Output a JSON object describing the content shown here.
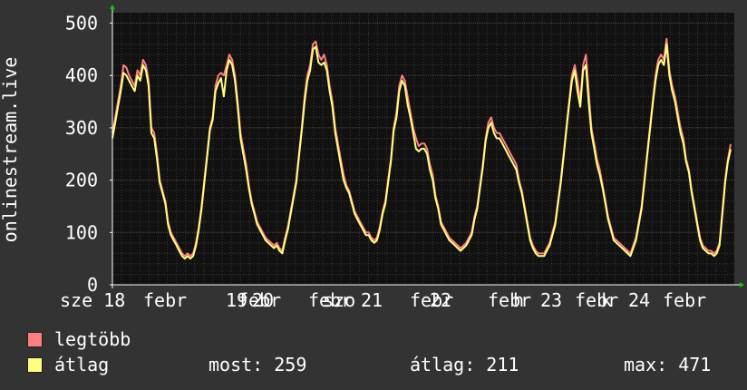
{
  "chart_data": {
    "type": "line",
    "ylabel": "onlinestream.live",
    "ylim": [
      0,
      520
    ],
    "yticks": [
      0,
      100,
      200,
      300,
      400,
      500
    ],
    "grid": true,
    "x_tick_labels": [
      "sze 18",
      "febr",
      "19",
      "febr",
      "20",
      "febr",
      "szo",
      "21",
      "febr",
      "22",
      "febr",
      "h",
      "23",
      "febr",
      "k",
      "24",
      "febr"
    ],
    "series": [
      {
        "name": "legtöbb",
        "color": "#ff7f7f",
        "values": [
          290,
          320,
          350,
          380,
          420,
          415,
          400,
          390,
          380,
          410,
          400,
          430,
          420,
          390,
          300,
          290,
          250,
          200,
          180,
          160,
          120,
          100,
          90,
          80,
          70,
          60,
          55,
          60,
          55,
          60,
          80,
          110,
          150,
          200,
          250,
          300,
          320,
          380,
          400,
          405,
          400,
          420,
          440,
          430,
          400,
          350,
          290,
          260,
          230,
          190,
          160,
          140,
          120,
          110,
          100,
          90,
          85,
          80,
          75,
          80,
          70,
          65,
          90,
          110,
          140,
          170,
          200,
          250,
          300,
          360,
          400,
          420,
          460,
          465,
          440,
          430,
          440,
          420,
          380,
          350,
          300,
          270,
          240,
          210,
          190,
          180,
          160,
          140,
          130,
          120,
          110,
          100,
          100,
          90,
          85,
          90,
          110,
          140,
          160,
          200,
          240,
          300,
          330,
          380,
          400,
          390,
          360,
          330,
          300,
          280,
          265,
          270,
          270,
          260,
          230,
          210,
          170,
          150,
          120,
          110,
          100,
          90,
          85,
          80,
          75,
          70,
          75,
          80,
          90,
          100,
          130,
          150,
          190,
          230,
          280,
          310,
          320,
          300,
          290,
          290,
          280,
          270,
          260,
          250,
          240,
          230,
          200,
          180,
          150,
          120,
          90,
          75,
          65,
          60,
          60,
          60,
          70,
          80,
          100,
          120,
          160,
          200,
          250,
          300,
          350,
          400,
          420,
          390,
          350,
          420,
          440,
          370,
          300,
          270,
          240,
          220,
          190,
          160,
          130,
          110,
          90,
          85,
          80,
          75,
          70,
          65,
          60,
          75,
          90,
          120,
          150,
          200,
          250,
          300,
          350,
          400,
          430,
          440,
          430,
          470,
          410,
          380,
          360,
          330,
          300,
          280,
          240,
          220,
          180,
          150,
          120,
          90,
          75,
          70,
          65,
          65,
          60,
          65,
          80,
          140,
          200,
          240,
          269
        ]
      },
      {
        "name": "átlag",
        "color": "#ffff80",
        "values": [
          280,
          310,
          340,
          370,
          405,
          400,
          390,
          380,
          370,
          400,
          390,
          420,
          410,
          380,
          290,
          280,
          240,
          195,
          175,
          155,
          115,
          95,
          85,
          75,
          65,
          55,
          50,
          55,
          50,
          55,
          75,
          105,
          145,
          195,
          245,
          295,
          315,
          370,
          385,
          395,
          360,
          410,
          430,
          420,
          390,
          340,
          280,
          250,
          220,
          185,
          155,
          135,
          115,
          105,
          95,
          85,
          80,
          75,
          70,
          75,
          65,
          60,
          85,
          105,
          135,
          165,
          195,
          245,
          295,
          350,
          390,
          410,
          450,
          455,
          425,
          420,
          425,
          410,
          370,
          340,
          290,
          260,
          230,
          200,
          185,
          175,
          155,
          135,
          125,
          115,
          105,
          95,
          95,
          85,
          80,
          85,
          105,
          135,
          155,
          195,
          235,
          295,
          320,
          370,
          390,
          380,
          345,
          320,
          290,
          260,
          255,
          260,
          260,
          250,
          220,
          200,
          165,
          145,
          115,
          105,
          95,
          85,
          80,
          75,
          70,
          65,
          70,
          75,
          85,
          95,
          125,
          145,
          185,
          225,
          275,
          300,
          310,
          290,
          280,
          280,
          270,
          260,
          250,
          240,
          230,
          220,
          195,
          175,
          145,
          115,
          85,
          70,
          60,
          55,
          55,
          55,
          65,
          75,
          95,
          115,
          155,
          195,
          245,
          295,
          345,
          390,
          410,
          370,
          340,
          410,
          420,
          350,
          290,
          260,
          230,
          210,
          185,
          155,
          125,
          105,
          85,
          80,
          75,
          70,
          65,
          60,
          55,
          70,
          85,
          115,
          145,
          195,
          245,
          295,
          345,
          390,
          420,
          430,
          420,
          460,
          400,
          370,
          350,
          320,
          290,
          270,
          235,
          215,
          175,
          145,
          115,
          85,
          70,
          65,
          60,
          60,
          55,
          60,
          75,
          135,
          195,
          235,
          259
        ]
      }
    ]
  },
  "legend": {
    "items": [
      {
        "label": "legtöbb",
        "color": "#ff7f7f"
      },
      {
        "label": "átlag",
        "color": "#ffff80"
      }
    ],
    "stats": {
      "current": "most: 259",
      "average": "átlag: 211",
      "max": "max: 471"
    }
  }
}
